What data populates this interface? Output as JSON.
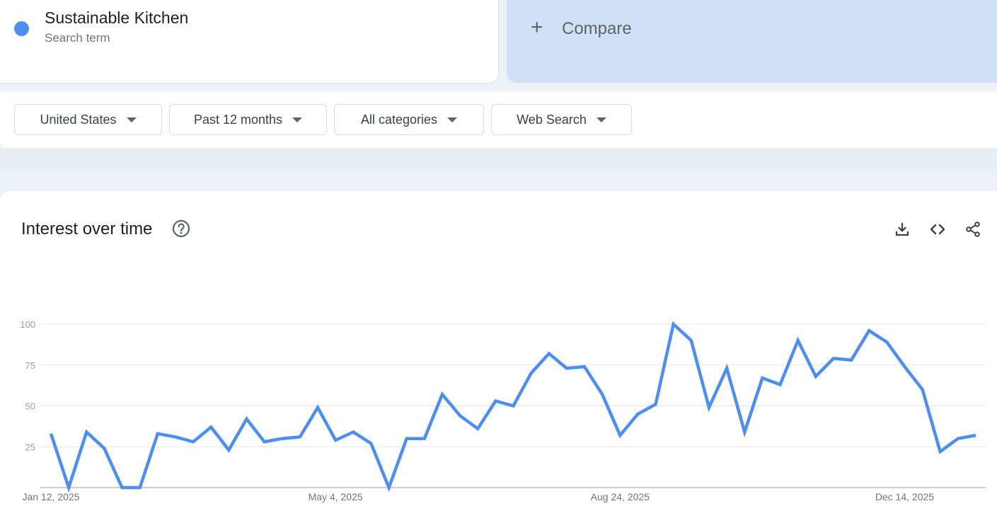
{
  "term": {
    "title": "Sustainable Kitchen",
    "subtitle": "Search term",
    "color": "#4d8ef0"
  },
  "compare": {
    "plus": "+",
    "label": "Compare"
  },
  "filters": [
    {
      "label": "United States"
    },
    {
      "label": "Past 12 months"
    },
    {
      "label": "All categories"
    },
    {
      "label": "Web Search"
    }
  ],
  "panel": {
    "title": "Interest over time",
    "icons": [
      "help-icon",
      "download-icon",
      "embed-code-icon",
      "share-icon"
    ]
  },
  "chart_data": {
    "type": "line",
    "title": "Interest over time",
    "ylim": [
      0,
      100
    ],
    "yticks": [
      25,
      50,
      75,
      100
    ],
    "grid": true,
    "x_tick_labels": [
      {
        "label": "Jan 12, 2025",
        "index": 0
      },
      {
        "label": "May 4, 2025",
        "index": 16
      },
      {
        "label": "Aug 24, 2025",
        "index": 32
      },
      {
        "label": "Dec 14, 2025",
        "index": 48
      }
    ],
    "series": [
      {
        "color": "#4d8ef0",
        "values": [
          33,
          0,
          34,
          24,
          0,
          0,
          33,
          31,
          28,
          37,
          23,
          42,
          28,
          30,
          31,
          49,
          29,
          34,
          27,
          0,
          30,
          30,
          57,
          44,
          36,
          53,
          50,
          70,
          82,
          73,
          74,
          57,
          32,
          45,
          51,
          100,
          90,
          49,
          73,
          34,
          67,
          63,
          90,
          68,
          79,
          78,
          96,
          89,
          74,
          60,
          22,
          30,
          32
        ]
      }
    ]
  }
}
